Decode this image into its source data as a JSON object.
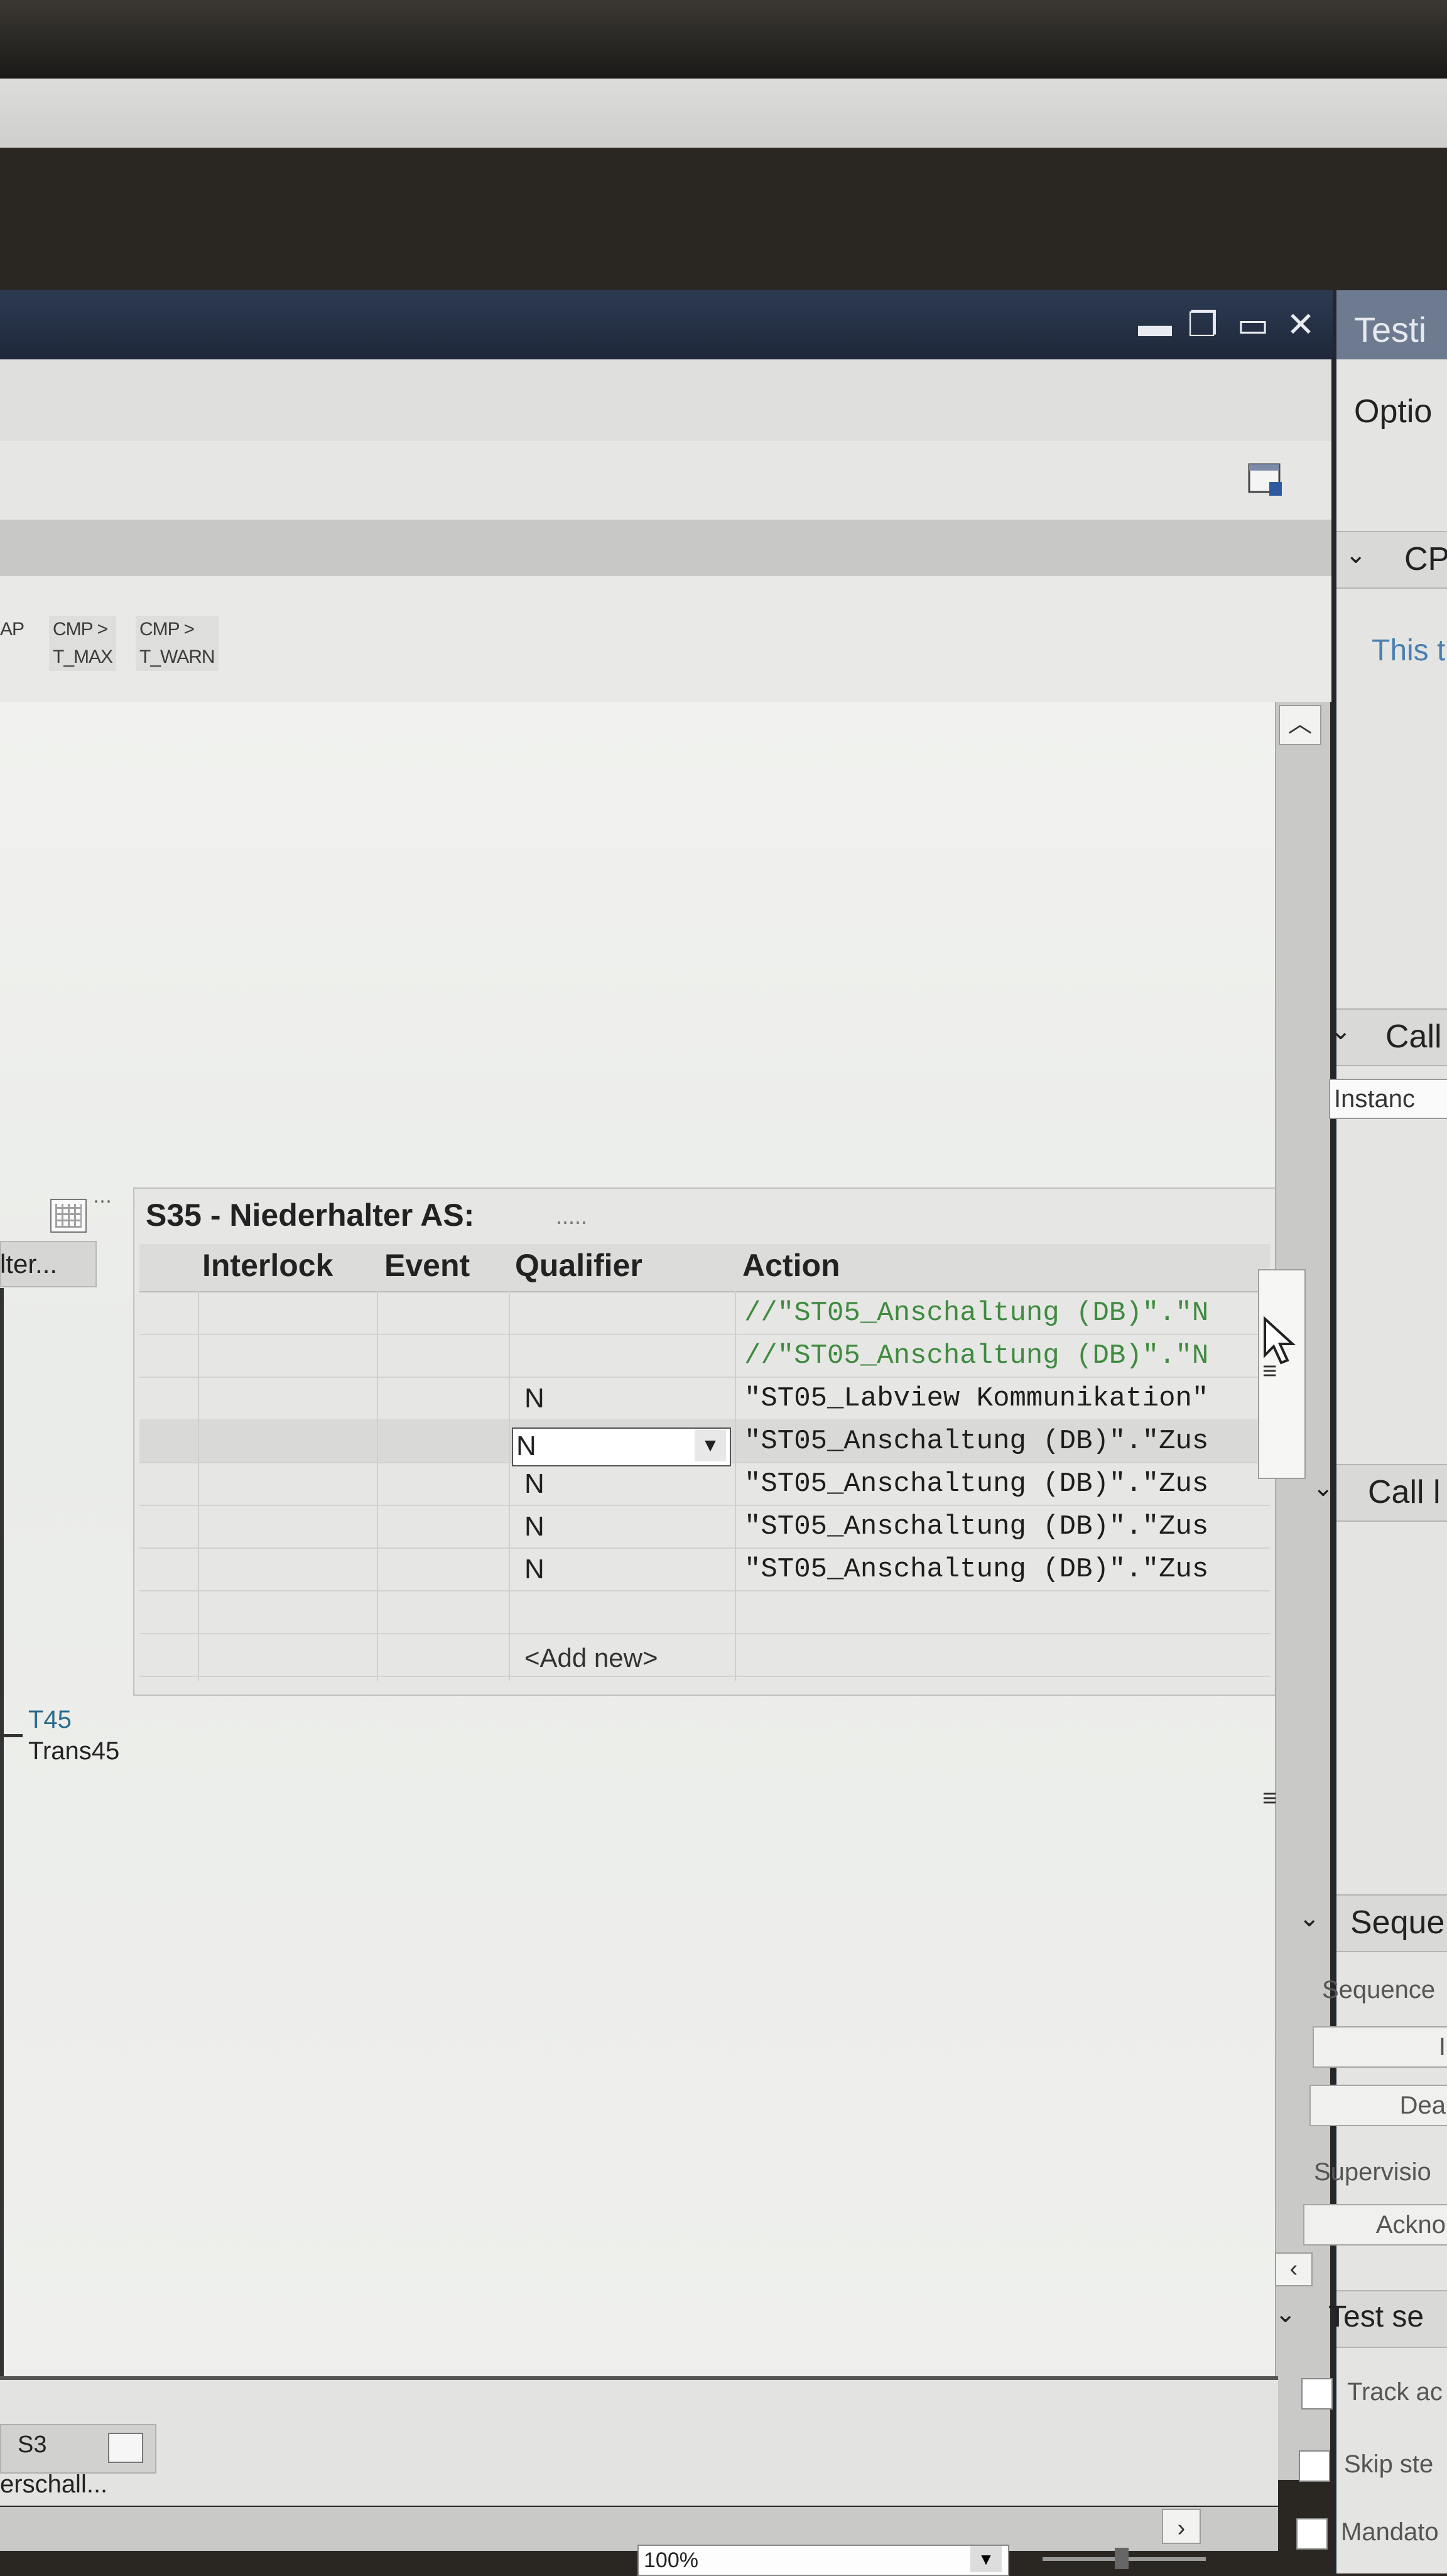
{
  "window": {
    "minimize": "▬",
    "restore": "❐",
    "maximize": "▭",
    "close": "✕"
  },
  "cmp_columns": [
    {
      "line1": "AP",
      "line2": ""
    },
    {
      "line1": "CMP >",
      "line2": "T_MAX"
    },
    {
      "line1": "CMP >",
      "line2": "T_WARN"
    }
  ],
  "step_table": {
    "title": "S35 - Niederhalter AS:",
    "dots": ".....",
    "headers": {
      "interlock": "Interlock",
      "event": "Event",
      "qualifier": "Qualifier",
      "action": "Action"
    },
    "rows": [
      {
        "qualifier": "",
        "action": "//\"ST05_Anschaltung (DB)\".\"N",
        "comment": true
      },
      {
        "qualifier": "",
        "action": "//\"ST05_Anschaltung (DB)\".\"N",
        "comment": true
      },
      {
        "qualifier": "N",
        "action": "\"ST05_Labview Kommunikation\"",
        "comment": false
      },
      {
        "qualifier": "N",
        "action": "\"ST05_Anschaltung (DB)\".\"Zus",
        "comment": false,
        "selected": true
      },
      {
        "qualifier": "N",
        "action": "\"ST05_Anschaltung (DB)\".\"Zus",
        "comment": false
      },
      {
        "qualifier": "N",
        "action": "\"ST05_Anschaltung (DB)\".\"Zus",
        "comment": false
      },
      {
        "qualifier": "N",
        "action": "\"ST05_Anschaltung (DB)\".\"Zus",
        "comment": false
      }
    ],
    "add_new": "<Add new>"
  },
  "left": {
    "tab_text": "lter...",
    "transition_id": "T45",
    "transition_name": "Trans45",
    "bottom_tab": "S3",
    "bottom_text": "erschall..."
  },
  "zoom": "100%",
  "right_panel": {
    "title": "Testi",
    "options": "Optio",
    "cpu_section": "CP",
    "cpu_text": "This t",
    "call_section": "Call",
    "instance_field": "Instanc",
    "call2_section": "Call l",
    "sequence_section": "Seque",
    "sequence_label": "Sequence",
    "btn1": "I",
    "btn2": "Dea",
    "supervision_label": "Supervisio",
    "ack_btn": "Ackno",
    "test_section": "Test se",
    "chk1": "Track ac",
    "chk2": "Skip ste",
    "chk3": "Mandato"
  }
}
